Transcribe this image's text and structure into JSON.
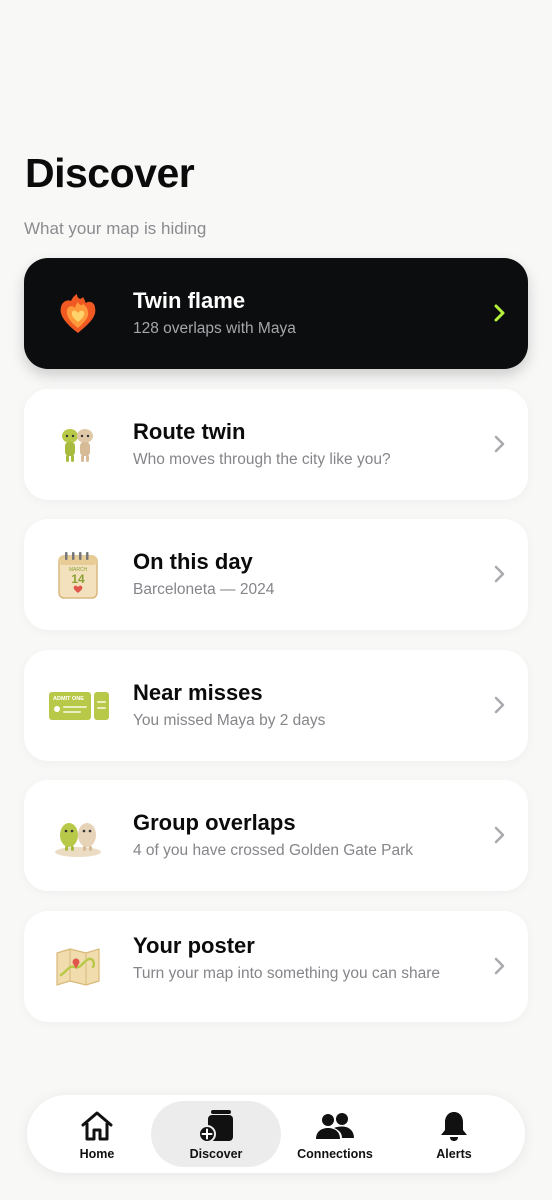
{
  "header": {
    "title": "Discover",
    "subtitle": "What your map is hiding"
  },
  "cards": [
    {
      "title": "Twin flame",
      "subtitle": "128 overlaps with Maya",
      "icon": "heart-fire-icon",
      "style": "dark",
      "chevron_color": "#b5f03a"
    },
    {
      "title": "Route twin",
      "subtitle": "Who moves through the city like you?",
      "icon": "twin-figures-icon"
    },
    {
      "title": "On this day",
      "subtitle": "Barceloneta — 2024",
      "icon": "calendar-icon",
      "calendar_month": "MARCH",
      "calendar_day": "14"
    },
    {
      "title": "Near misses",
      "subtitle": "You missed Maya by 2 days",
      "icon": "ticket-icon",
      "ticket_text": "ADMIT ONE"
    },
    {
      "title": "Group overlaps",
      "subtitle": "4 of you have crossed Golden Gate Park",
      "icon": "group-figures-icon"
    },
    {
      "title": "Your poster",
      "subtitle": "Turn your map into something you can share",
      "icon": "folded-map-icon"
    }
  ],
  "nav": {
    "items": [
      {
        "label": "Home",
        "icon": "home-icon",
        "active": false
      },
      {
        "label": "Discover",
        "icon": "discover-cards-icon",
        "active": true
      },
      {
        "label": "Connections",
        "icon": "people-icon",
        "active": false
      },
      {
        "label": "Alerts",
        "icon": "bell-icon",
        "active": false
      }
    ]
  },
  "colors": {
    "background": "#f8f8f7",
    "dark_card": "#0c0d0f",
    "accent_green": "#b5f03a",
    "chevron_gray": "#a9a9ae"
  }
}
